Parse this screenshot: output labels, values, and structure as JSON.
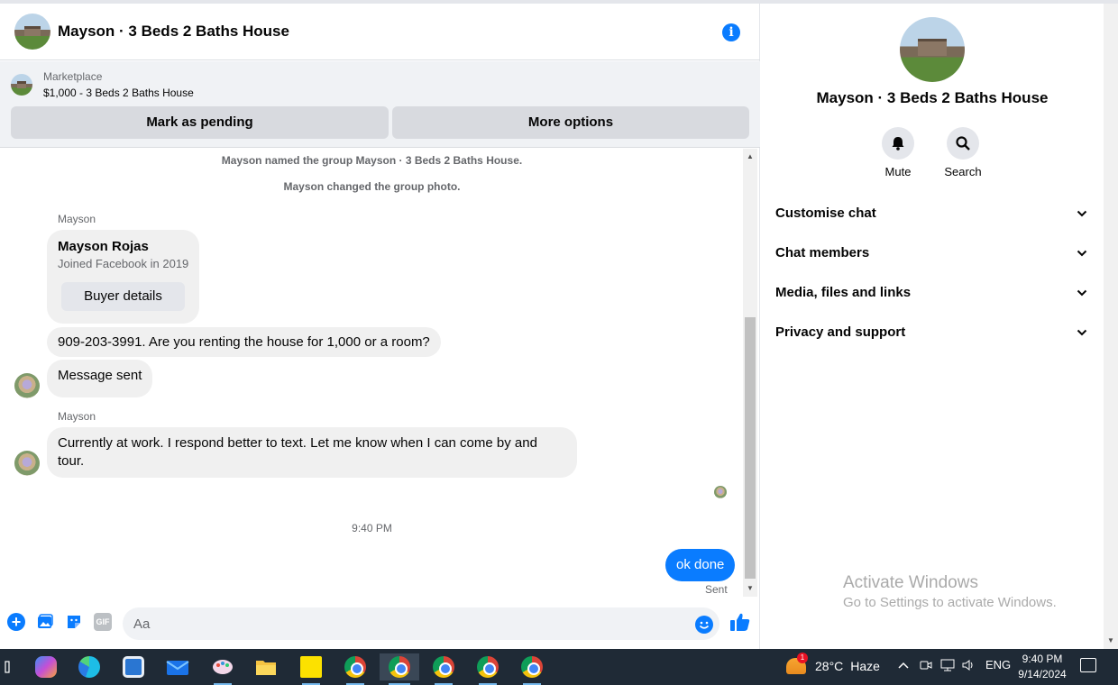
{
  "chat": {
    "title": "Mayson · 3 Beds 2 Baths House",
    "marketplace": {
      "label": "Marketplace",
      "listing": "$1,000 - 3 Beds 2 Baths House",
      "pending_button": "Mark as pending",
      "more_button": "More options"
    },
    "system_messages": [
      "Mayson named the group Mayson · 3 Beds 2 Baths House.",
      "Mayson changed the group photo."
    ],
    "sender_name": "Mayson",
    "buyer_card": {
      "name": "Mayson Rojas",
      "joined": "Joined Facebook in 2019",
      "button": "Buyer details"
    },
    "messages": [
      "909-203-3991. Are you renting the house for 1,000 or a room?",
      "Message sent",
      "Currently at work. I respond better to text. Let me know when I can come by and tour."
    ],
    "timestamp": "9:40 PM",
    "outgoing": {
      "text": "ok done",
      "status": "Sent"
    },
    "composer": {
      "placeholder": "Aa",
      "gif_label": "GIF"
    },
    "accent_color": "#0a7cff"
  },
  "details": {
    "title": "Mayson · 3 Beds 2 Baths House",
    "actions": [
      {
        "label": "Mute",
        "icon": "bell-icon"
      },
      {
        "label": "Search",
        "icon": "search-icon"
      }
    ],
    "sections": [
      "Customise chat",
      "Chat members",
      "Media, files and links",
      "Privacy and support"
    ],
    "watermark": {
      "title": "Activate Windows",
      "subtitle": "Go to Settings to activate Windows."
    }
  },
  "taskbar": {
    "weather": {
      "temp": "28°C",
      "condition": "Haze",
      "badge": "1"
    },
    "language": "ENG",
    "time": "9:40 PM",
    "date": "9/14/2024"
  }
}
